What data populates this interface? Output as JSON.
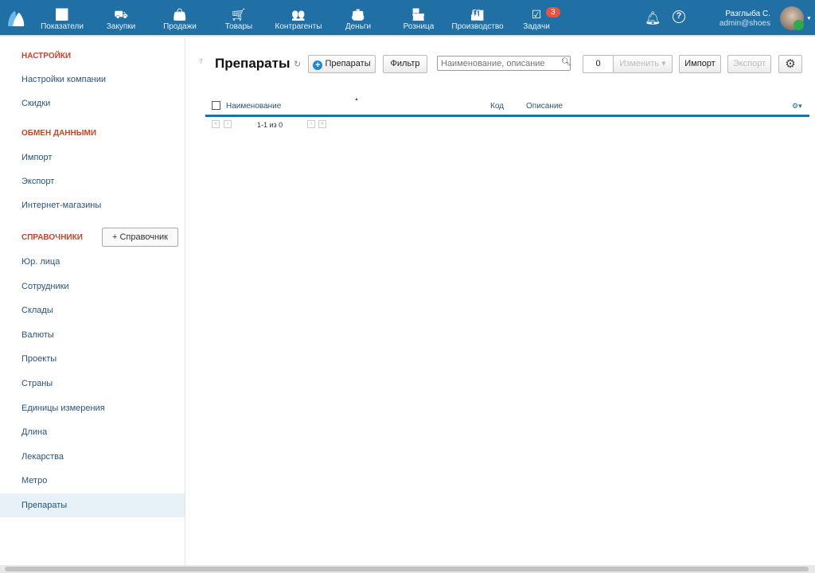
{
  "nav": [
    {
      "label": "Показатели",
      "icon": "chart-icon",
      "glyph": "📈"
    },
    {
      "label": "Закупки",
      "icon": "cart-dolly-icon",
      "glyph": "⛟"
    },
    {
      "label": "Продажи",
      "icon": "bag-icon",
      "glyph": "👜"
    },
    {
      "label": "Товары",
      "icon": "cart-icon",
      "glyph": "🛒"
    },
    {
      "label": "Контрагенты",
      "icon": "people-icon",
      "glyph": "👥"
    },
    {
      "label": "Деньги",
      "icon": "wallet-icon",
      "glyph": "👛"
    },
    {
      "label": "Розница",
      "icon": "store-icon",
      "glyph": "🏪"
    },
    {
      "label": "Производство",
      "icon": "factory-icon",
      "glyph": "🏭"
    },
    {
      "label": "Задачи",
      "icon": "task-check-icon",
      "glyph": "☑"
    }
  ],
  "tasks_badge": "3",
  "user": {
    "name": "Разглыба С.",
    "email": "admin@shoes"
  },
  "sidebar": {
    "settings_header": "НАСТРОЙКИ",
    "settings": [
      "Настройки компании",
      "Скидки"
    ],
    "exchange_header": "ОБМЕН ДАННЫМИ",
    "exchange": [
      "Импорт",
      "Экспорт",
      "Интернет-магазины"
    ],
    "refs_header": "СПРАВОЧНИКИ",
    "add_ref": "+ Справочник",
    "refs": [
      "Юр. лица",
      "Сотрудники",
      "Склады",
      "Валюты",
      "Проекты",
      "Страны",
      "Единицы измерения",
      "Длина",
      "Лекарства",
      "Метро",
      "Препараты"
    ],
    "active": "Препараты"
  },
  "main": {
    "help": "?",
    "title": "Препараты",
    "add_button": "Препараты",
    "filter_button": "Фильтр",
    "search_placeholder": "Наименование, описание",
    "selected_count": "0",
    "change_button": "Изменить",
    "import_button": "Импорт",
    "export_button": "Экспорт",
    "columns": [
      "Наименование",
      "Код",
      "Описание"
    ],
    "pagination": "1-1 из 0"
  }
}
